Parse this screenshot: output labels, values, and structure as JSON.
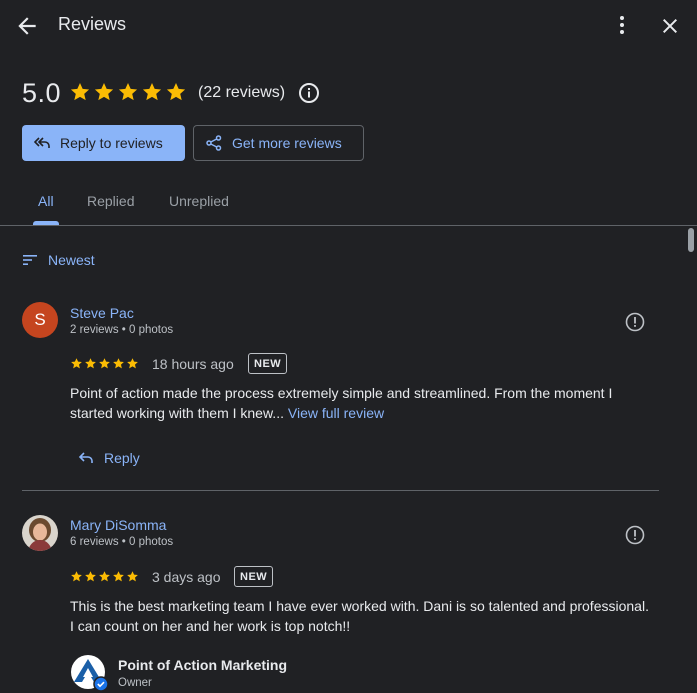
{
  "header": {
    "title": "Reviews",
    "back_icon": "arrow-back-icon",
    "more_icon": "more-vert-icon",
    "close_icon": "close-icon"
  },
  "summary": {
    "rating": "5.0",
    "stars": 5,
    "count_label": "(22 reviews)",
    "star_color": "#fbbc04"
  },
  "actions": {
    "reply_label": "Reply to reviews",
    "more_reviews_label": "Get more reviews"
  },
  "tabs": [
    {
      "label": "All",
      "active": true
    },
    {
      "label": "Replied",
      "active": false
    },
    {
      "label": "Unreplied",
      "active": false
    }
  ],
  "sort": {
    "label": "Newest"
  },
  "reviews": [
    {
      "name": "Steve Pac",
      "initial": "S",
      "avatar_color": "#c5451f",
      "meta": "2 reviews • 0 photos",
      "stars": 5,
      "time": "18 hours ago",
      "badge": "NEW",
      "text": "Point of action made the process extremely simple and streamlined. From the moment I started working with them I knew...",
      "more_link": "View full review",
      "reply_label": "Reply"
    },
    {
      "name": "Mary DiSomma",
      "meta": "6 reviews • 0 photos",
      "stars": 5,
      "time": "3 days ago",
      "badge": "NEW",
      "text": "This is the best marketing team I have ever worked with. Dani is so talented and professional. I can count on her and her work is top notch!!",
      "owner": {
        "name": "Point of Action Marketing",
        "role": "Owner"
      }
    }
  ],
  "colors": {
    "background": "#202124",
    "accent": "#8ab4f8",
    "divider": "#5f6368"
  }
}
